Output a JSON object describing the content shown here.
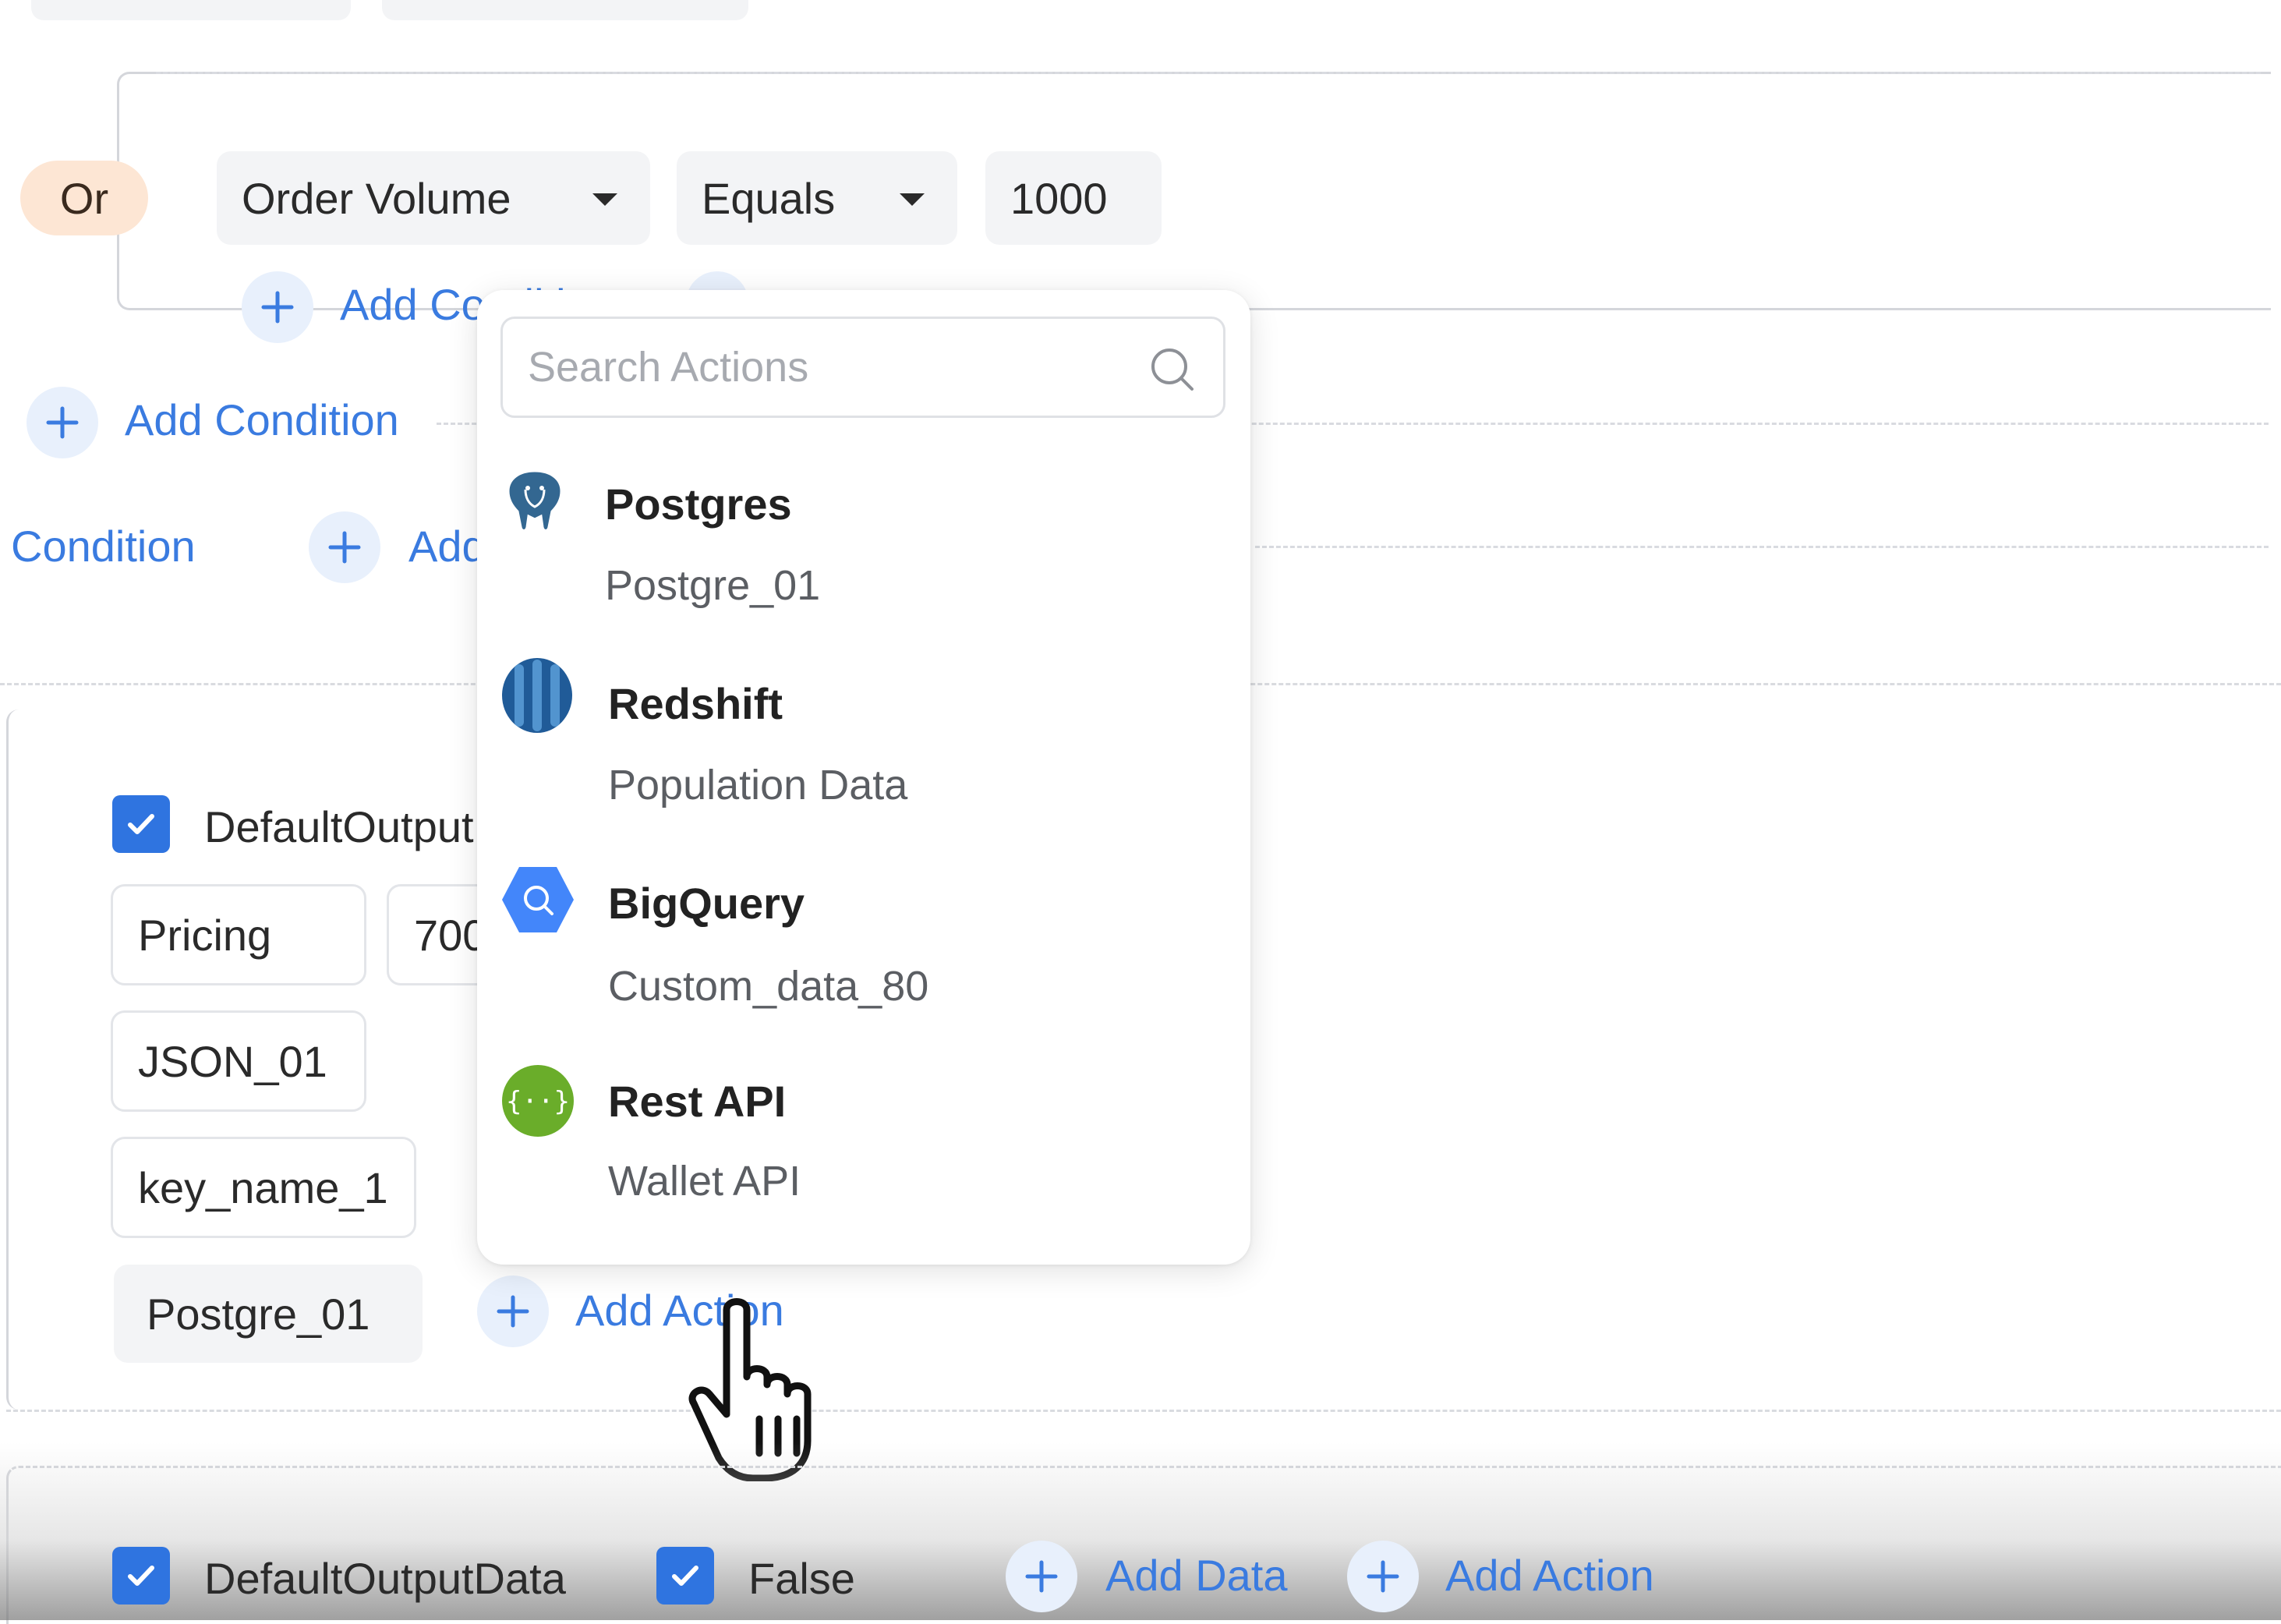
{
  "condition_group": {
    "operator": "Or",
    "field": "Order Volume",
    "comparator": "Equals",
    "value": "1000",
    "add_condition_inner": "Add Condition",
    "add_condition_outer": "Add Condition",
    "condition_label": "Condition",
    "add_partial": "Add"
  },
  "output": {
    "checkbox_label": "DefaultOutput",
    "fields": [
      "Pricing",
      "JSON_01",
      "key_name_1"
    ],
    "field_value": "700",
    "action_value": "Postgre_01",
    "add_action": "Add Action"
  },
  "dropdown": {
    "search_placeholder": "Search Actions",
    "options": [
      {
        "title": "Postgres",
        "subtitle": "Postgre_01",
        "icon": "postgres-icon"
      },
      {
        "title": "Redshift",
        "subtitle": "Population Data",
        "icon": "redshift-icon"
      },
      {
        "title": "BigQuery",
        "subtitle": "Custom_data_80",
        "icon": "bigquery-icon"
      },
      {
        "title": "Rest API",
        "subtitle": "Wallet API",
        "icon": "rest-api-icon"
      }
    ]
  },
  "footer": {
    "checkbox_1_label": "DefaultOutputData",
    "checkbox_2_label": "False",
    "add_data": "Add Data",
    "add_action": "Add Action"
  },
  "colors": {
    "accent": "#3a7be0",
    "checkbox": "#2f74e0",
    "or_badge": "#fde6d4",
    "postgres": "#336791",
    "redshift": "#205b98",
    "bigquery": "#4386fa",
    "rest_api": "#6aad2a"
  }
}
